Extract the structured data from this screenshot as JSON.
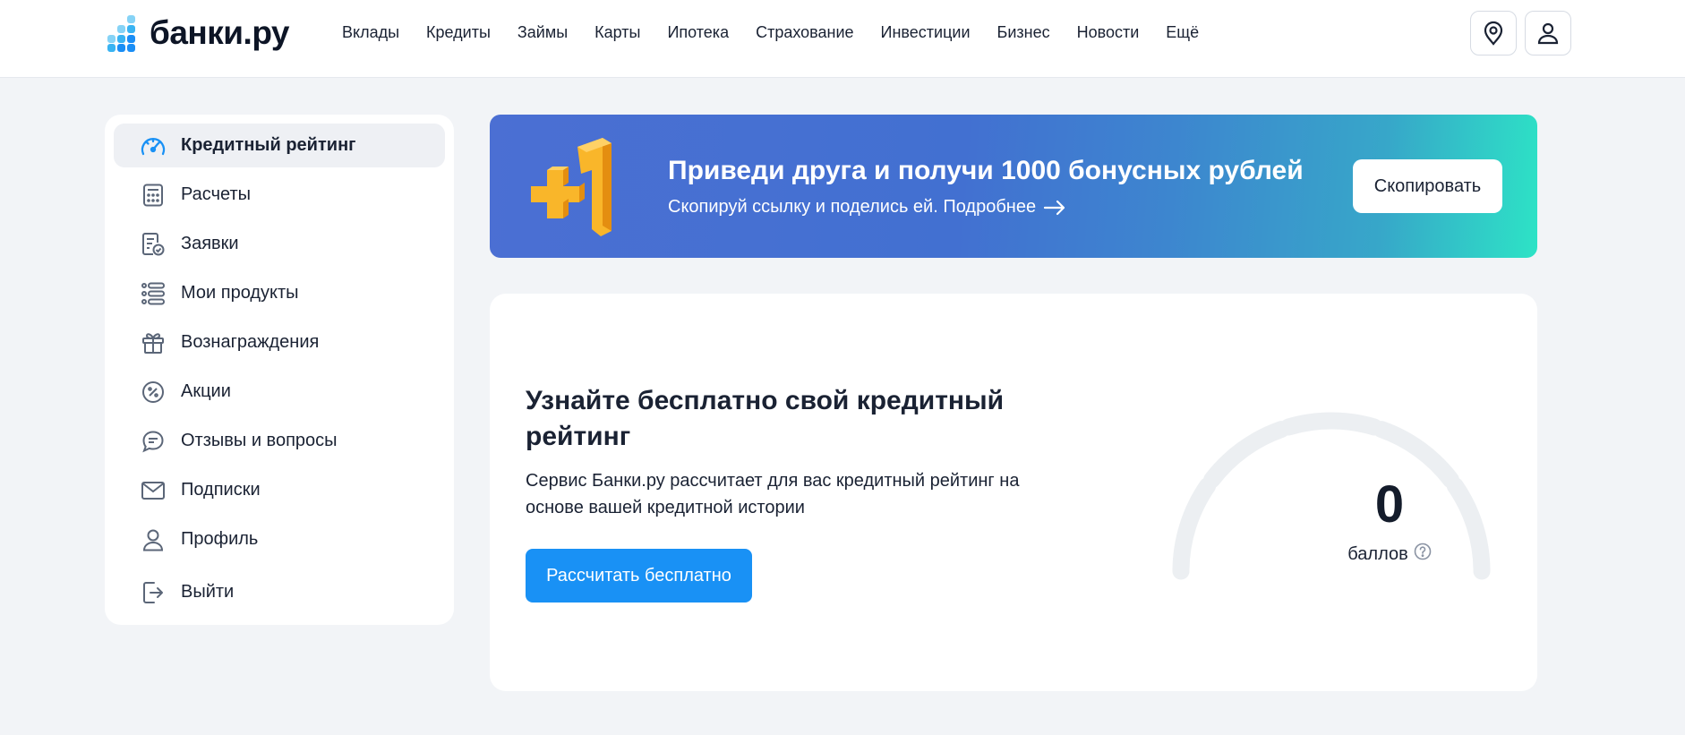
{
  "header": {
    "logo_text": "банки.ру",
    "nav": [
      "Вклады",
      "Кредиты",
      "Займы",
      "Карты",
      "Ипотека",
      "Страхование",
      "Инвестиции",
      "Бизнес",
      "Новости",
      "Ещё"
    ],
    "icons": [
      "location-icon",
      "user-icon"
    ]
  },
  "sidebar": {
    "items": [
      {
        "label": "Кредитный рейтинг",
        "icon": "speedometer-icon",
        "active": true
      },
      {
        "label": "Расчеты",
        "icon": "calculator-icon"
      },
      {
        "label": "Заявки",
        "icon": "document-check-icon"
      },
      {
        "label": "Мои продукты",
        "icon": "list-icon"
      },
      {
        "label": "Вознаграждения",
        "icon": "gift-icon"
      },
      {
        "label": "Акции",
        "icon": "percent-icon"
      },
      {
        "label": "Отзывы и вопросы",
        "icon": "chat-icon"
      },
      {
        "label": "Подписки",
        "icon": "mail-icon"
      },
      {
        "label": "Профиль",
        "icon": "person-icon"
      },
      {
        "label": "Выйти",
        "icon": "logout-icon"
      }
    ]
  },
  "banner": {
    "title": "Приведи друга и получи 1000 бонусных рублей",
    "subtitle": "Скопируй ссылку и поделись ей. Подробнее",
    "button": "Скопировать"
  },
  "rating": {
    "title": "Узнайте бесплатно свой кредитный рейтинг",
    "description": "Сервис Банки.ру рассчитает для вас кредитный рейтинг на основе вашей кредитной истории",
    "button": "Рассчитать бесплатно",
    "score": "0",
    "score_label": "баллов"
  },
  "colors": {
    "accent": "#1991f5",
    "background": "#f2f4f7",
    "gauge": "#eceff2"
  }
}
